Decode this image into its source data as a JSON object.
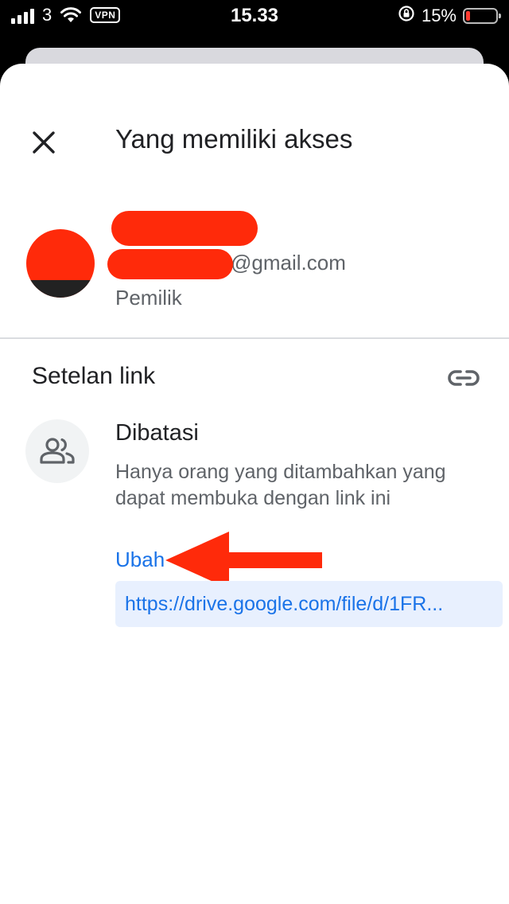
{
  "status_bar": {
    "carrier": "3",
    "vpn": "VPN",
    "time": "15.33",
    "battery_percent": "15%",
    "battery_level": 0.15
  },
  "dialog": {
    "title": "Yang memiliki akses",
    "close_icon": "close-icon"
  },
  "owner": {
    "email_visible": "@gmail.com",
    "role": "Pemilik"
  },
  "link_settings": {
    "title": "Setelan link",
    "icon": "link-icon",
    "access_icon": "people-icon",
    "access_label": "Dibatasi",
    "access_description": "Hanya orang yang ditambahkan yang dapat membuka dengan link ini",
    "change_label": "Ubah",
    "url": "https://drive.google.com/file/d/1FR..."
  },
  "colors": {
    "accent": "#1a73e8",
    "annotation_red": "#ff2a0a",
    "url_background": "#e8f0fe"
  }
}
